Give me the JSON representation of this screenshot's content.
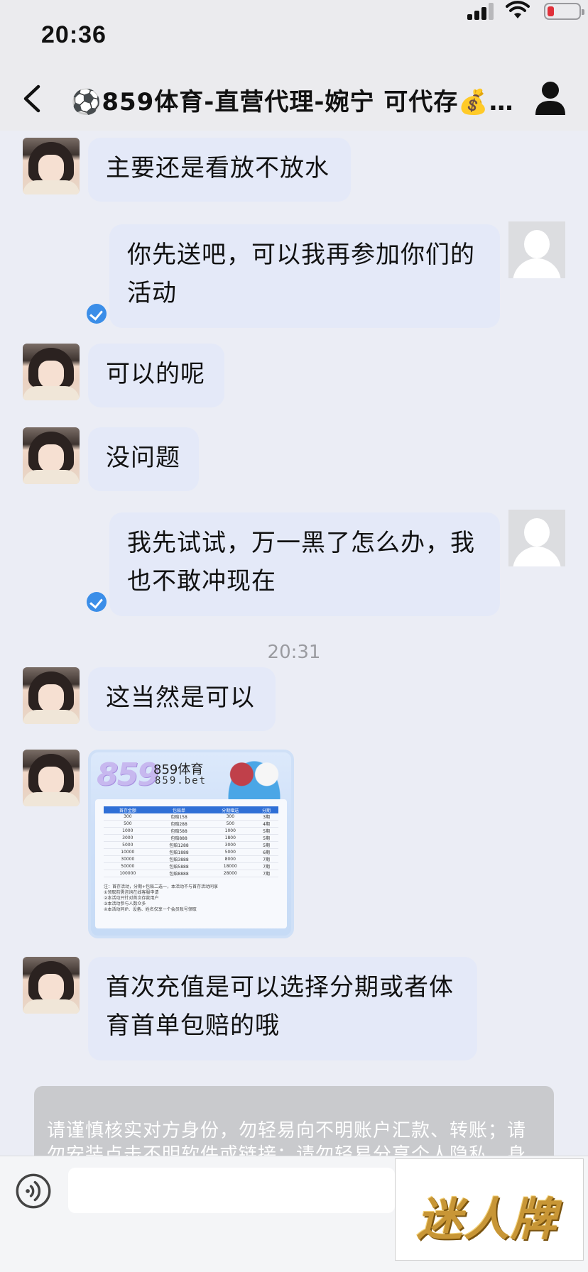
{
  "status_bar": {
    "time": "20:36"
  },
  "nav": {
    "title": "⚽859体育-直营代理-婉宁  可代存💰…"
  },
  "messages": [
    {
      "side": "left",
      "text": "主要还是看放不放水"
    },
    {
      "side": "right",
      "text_line1": "你先送吧，可以我再参加你们的",
      "text_line2": "活动",
      "read": true
    },
    {
      "side": "left",
      "text": "可以的呢"
    },
    {
      "side": "left",
      "text": "没问题"
    },
    {
      "side": "right",
      "text_line1": "我先试试，万一黑了怎么办，我",
      "text_line2": "也不敢冲现在",
      "read": true
    },
    {
      "side": "left",
      "text": "这当然是可以"
    },
    {
      "side": "left",
      "type": "image"
    },
    {
      "side": "left",
      "text_line1": "首次充值是可以选择分期或者体",
      "text_line2": "育首单包赔的哦"
    }
  ],
  "timestamp": "20:31",
  "promo": {
    "logo": "859",
    "brand": "859体育",
    "url": "859.bet",
    "columns": [
      "首存金额",
      "包赔单",
      "分期赠送",
      "分期"
    ],
    "rows": [
      [
        "300",
        "包赔158",
        "300",
        "3期"
      ],
      [
        "500",
        "包赔288",
        "500",
        "4期"
      ],
      [
        "1000",
        "包赔588",
        "1000",
        "5期"
      ],
      [
        "3000",
        "包赔888",
        "1800",
        "5期"
      ],
      [
        "5000",
        "包赔1288",
        "3000",
        "5期"
      ],
      [
        "10000",
        "包赔1888",
        "5000",
        "6期"
      ],
      [
        "30000",
        "包赔3888",
        "8000",
        "7期"
      ],
      [
        "50000",
        "包赔5888",
        "18000",
        "7期"
      ],
      [
        "100000",
        "包赔8888",
        "28000",
        "7期"
      ]
    ],
    "notes": [
      "注：首存活动，分期+包赔二选一，本活动不与首存活动同享",
      "①领取前需咨询在线客服申请",
      "②本活动只针对首次存款用户",
      "③本活动参与人数众多",
      "④本活动同IP、设备、姓名仅享一个会员账号领取"
    ]
  },
  "warning": {
    "line1": "请谨慎核实对方身份，勿轻易向不明账户汇款、转账；请",
    "line2": "勿安装点击不明软件或链接；请勿轻易分享个人隐私、身"
  },
  "input": {
    "placeholder": ""
  },
  "watermark": {
    "text": "迷人牌"
  }
}
